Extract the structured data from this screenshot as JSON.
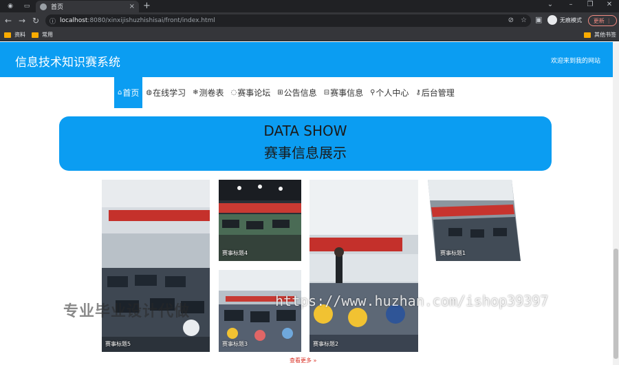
{
  "browser": {
    "tab_title": "首页",
    "url_host": "localhost",
    "url_path": ":8080/xinxijishuzhishisai/front/index.html",
    "profile_label": "无痕模式",
    "update_label": "更新",
    "bookmarks": [
      "资料",
      "常用"
    ],
    "other_bookmarks": "其他书签"
  },
  "header": {
    "title": "信息技术知识赛系统",
    "welcome": "欢迎来到我的网站"
  },
  "nav": {
    "items": [
      {
        "icon": "⌂",
        "label": "首页",
        "active": true
      },
      {
        "icon": "◍",
        "label": "在线学习",
        "active": false
      },
      {
        "icon": "❄",
        "label": "测卷表",
        "active": false
      },
      {
        "icon": "◌",
        "label": "赛事论坛",
        "active": false
      },
      {
        "icon": "⊞",
        "label": "公告信息",
        "active": false
      },
      {
        "icon": "⊟",
        "label": "赛事信息",
        "active": false
      },
      {
        "icon": "⚲",
        "label": "个人中心",
        "active": false
      },
      {
        "icon": "⚷",
        "label": "后台管理",
        "active": false
      }
    ]
  },
  "banner": {
    "title_en": "DATA SHOW",
    "title_cn": "赛事信息展示"
  },
  "gallery": {
    "cards": [
      {
        "caption": "赛事标题5"
      },
      {
        "caption": "赛事标题4"
      },
      {
        "caption": "赛事标题3"
      },
      {
        "caption": "赛事标题2"
      },
      {
        "caption": "赛事标题1"
      }
    ],
    "more_label": "查看更多 »"
  },
  "watermarks": {
    "left": "专业毕业设计代做",
    "right": "https://www.huzhan.com/ishop39397"
  },
  "colors": {
    "primary": "#0b9df2",
    "chrome_dark": "#202124",
    "chrome_mid": "#35363a"
  }
}
